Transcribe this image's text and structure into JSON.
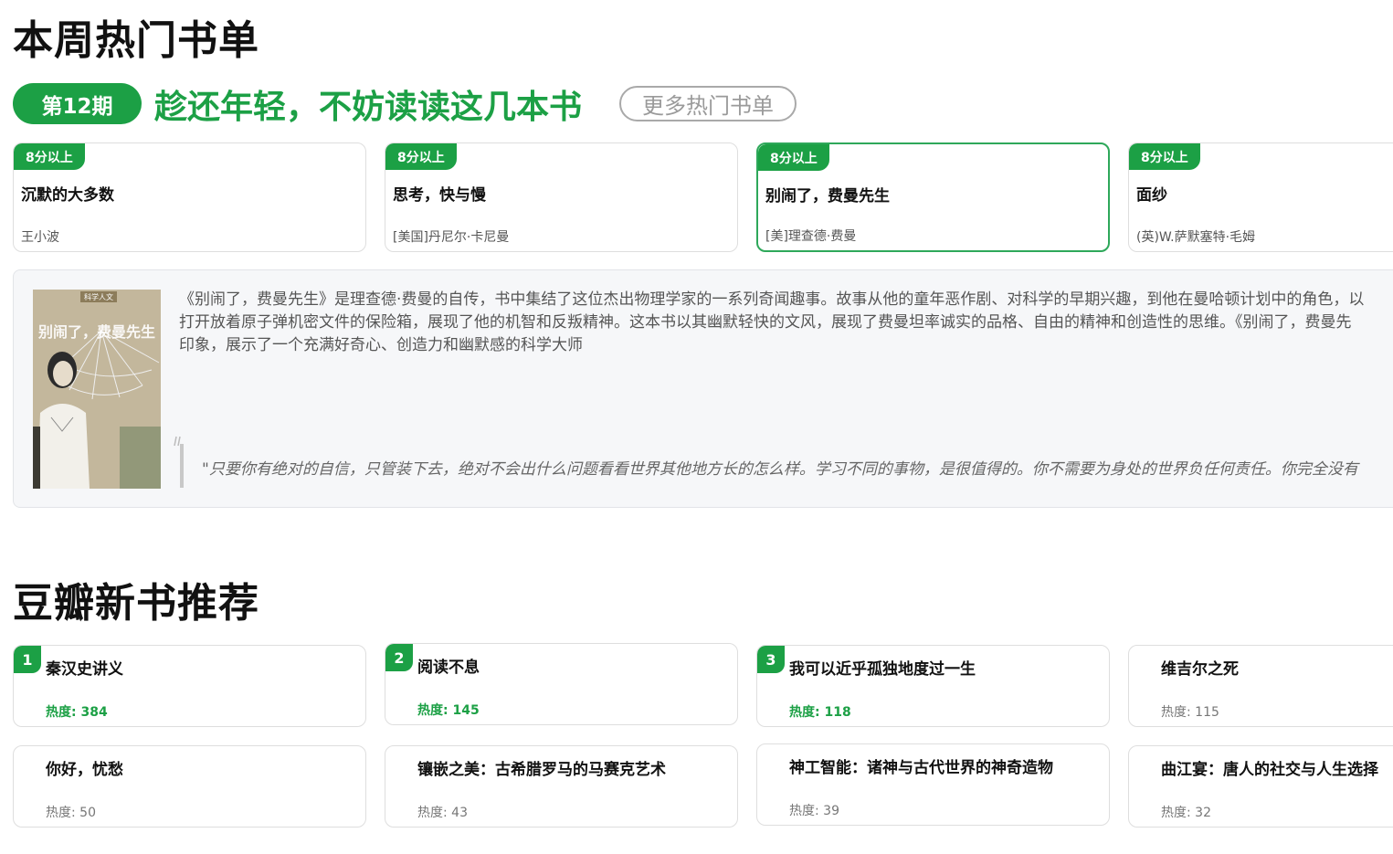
{
  "hot_section": {
    "title": "本周热门书单",
    "issue_label": "第12期",
    "headline": "趁还年轻，不妨读读这几本书",
    "more_button": "更多热门书单",
    "books": [
      {
        "tag": "8分以上",
        "title": "沉默的大多数",
        "author": "王小波",
        "active": false
      },
      {
        "tag": "8分以上",
        "title": "思考，快与慢",
        "author": "[美国]丹尼尔·卡尼曼",
        "active": false
      },
      {
        "tag": "8分以上",
        "title": "别闹了，费曼先生",
        "author": "[美]理查德·费曼",
        "active": true
      },
      {
        "tag": "8分以上",
        "title": "面纱",
        "author": "(英)W.萨默塞特·毛姆",
        "active": false
      }
    ],
    "detail": {
      "cover_title": "别闹了，费曼先生",
      "cover_series": "科学人文",
      "description_lines": [
        "《别闹了，费曼先生》是理查德·费曼的自传，书中集结了这位杰出物理学家的一系列奇闻趣事。故事从他的童年恶作剧、对科学的早期兴趣，到他在曼哈顿计划中的角色，以",
        "打开放着原子弹机密文件的保险箱，展现了他的机智和反叛精神。这本书以其幽默轻快的文风，展现了费曼坦率诚实的品格、自由的精神和创造性的思维。《别闹了，费曼先",
        "印象，展示了一个充满好奇心、创造力和幽默感的科学大师"
      ],
      "quote": "\"只要你有绝对的自信，只管装下去，绝对不会出什么问题看看世界其他地方长的怎么样。学习不同的事物，是很值得的。你不需要为身处的世界负任何责任。你完全没有"
    }
  },
  "new_section": {
    "title": "豆瓣新书推荐",
    "books": [
      {
        "rank": "1",
        "title": "秦汉史讲义",
        "heat": "热度: 384",
        "hot": true
      },
      {
        "rank": "2",
        "title": "阅读不息",
        "heat": "热度: 145",
        "hot": true
      },
      {
        "rank": "3",
        "title": "我可以近乎孤独地度过一生",
        "heat": "热度: 118",
        "hot": true
      },
      {
        "rank": "",
        "title": "维吉尔之死",
        "heat": "热度: 115",
        "hot": false
      },
      {
        "rank": "",
        "title": "你好，忧愁",
        "heat": "热度: 50",
        "hot": false
      },
      {
        "rank": "",
        "title": "镶嵌之美：古希腊罗马的马赛克艺术",
        "heat": "热度: 43",
        "hot": false
      },
      {
        "rank": "",
        "title": "神工智能：诸神与古代世界的神奇造物",
        "heat": "热度: 39",
        "hot": false
      },
      {
        "rank": "",
        "title": "曲江宴：唐人的社交与人生选择",
        "heat": "热度: 32",
        "hot": false
      }
    ]
  },
  "colors": {
    "accent": "#1ca045",
    "active_border": "#2ea85a",
    "panel_bg": "#f6f7f9"
  }
}
